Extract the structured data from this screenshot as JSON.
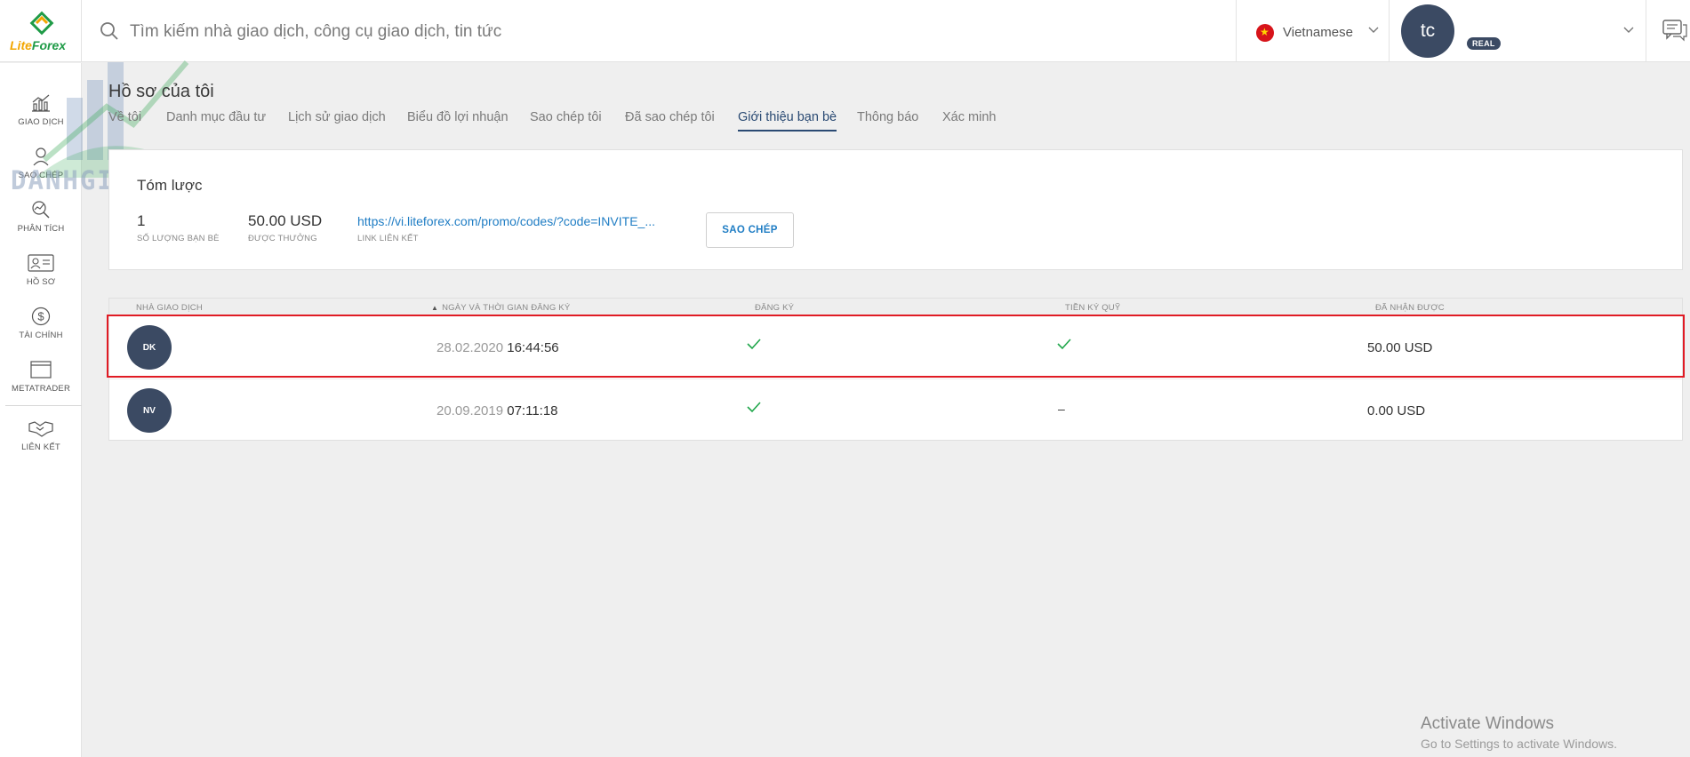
{
  "brand": {
    "logo_text_a": "Lite",
    "logo_text_b": "Forex"
  },
  "search": {
    "placeholder": "Tìm kiếm nhà giao dịch, công cụ giao dịch, tin tức"
  },
  "language": {
    "label": "Vietnamese"
  },
  "account": {
    "initials": "tc",
    "badge": "REAL"
  },
  "sidebar": {
    "items": [
      {
        "label": "GIAO DỊCH",
        "icon": "trading-chart-icon"
      },
      {
        "label": "SAO CHÉP",
        "icon": "copy-trader-icon"
      },
      {
        "label": "PHÂN TÍCH",
        "icon": "analytics-icon"
      },
      {
        "label": "HỒ SƠ",
        "icon": "profile-card-icon"
      },
      {
        "label": "TÀI CHÍNH",
        "icon": "dollar-circle-icon"
      },
      {
        "label": "METATRADER",
        "icon": "window-icon"
      },
      {
        "label": "LIÊN KẾT",
        "icon": "handshake-icon"
      }
    ]
  },
  "watermark": {
    "text": "DANHGIASAN.COM"
  },
  "page": {
    "title": "Hồ sơ của tôi"
  },
  "tabs": [
    {
      "label": "Về tôi"
    },
    {
      "label": "Danh mục đầu tư"
    },
    {
      "label": "Lịch sử giao dịch"
    },
    {
      "label": "Biểu đồ lợi nhuận"
    },
    {
      "label": "Sao chép tôi"
    },
    {
      "label": "Đã sao chép tôi"
    },
    {
      "label": "Giới thiệu bạn bè",
      "active": true
    },
    {
      "label": "Thông báo"
    },
    {
      "label": "Xác minh"
    }
  ],
  "summary": {
    "title": "Tóm lược",
    "friends_count": "1",
    "friends_label": "SỐ LƯỢNG BẠN BÈ",
    "bonus_value": "50.00 USD",
    "bonus_label": "ĐƯỢC THƯỞNG",
    "link": "https://vi.liteforex.com/promo/codes/?code=INVITE_...",
    "link_label": "LINK LIÊN KẾT",
    "copy_button": "SAO CHÉP"
  },
  "table": {
    "headers": [
      "NHÀ GIAO DỊCH",
      "NGÀY VÀ THỜI GIAN ĐĂNG KÝ",
      "ĐĂNG KÝ",
      "TIỀN KÝ QUỸ",
      "ĐÃ NHẬN ĐƯỢC"
    ],
    "sort_indicator": "▲",
    "rows": [
      {
        "initials": "DK",
        "date": "28.02.2020",
        "time": "16:44:56",
        "registered": true,
        "deposit": "check",
        "earned": "50.00 USD"
      },
      {
        "initials": "NV",
        "date": "20.09.2019",
        "time": "07:11:18",
        "registered": true,
        "deposit": "–",
        "earned": "0.00 USD"
      }
    ]
  },
  "activate_windows": {
    "title": "Activate Windows",
    "subtitle": "Go to Settings to activate Windows."
  },
  "colors": {
    "accent": "#2a4a73",
    "link": "#1f7dc4",
    "avatar": "#3b4a63",
    "check": "#1fa64a",
    "highlight": "#e01b24"
  }
}
